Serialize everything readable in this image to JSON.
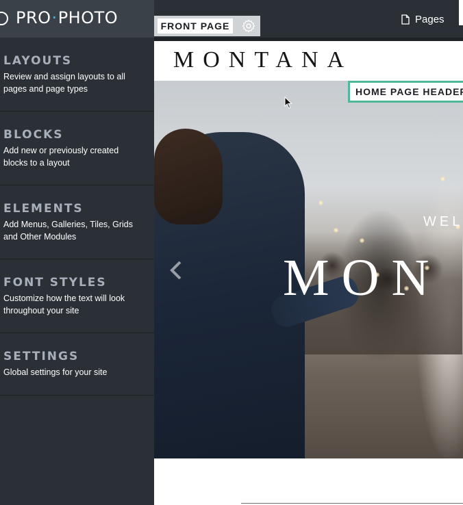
{
  "app": {
    "logo": {
      "left": "PRO",
      "dot": "·",
      "right": "PHOTO"
    }
  },
  "topbar": {
    "pages_label": "Pages"
  },
  "page_tab": {
    "label": "FRONT PAGE"
  },
  "sidebar": {
    "items": [
      {
        "title": "LAYOUTS",
        "description": "Review and assign layouts to all pages and page types"
      },
      {
        "title": "BLOCKS",
        "description": "Add new or previously created blocks to a layout"
      },
      {
        "title": "ELEMENTS",
        "description": "Add Menus, Galleries, Tiles, Grids and Other Modules"
      },
      {
        "title": "FONT STYLES",
        "description": "Customize how the text will look throughout your site"
      },
      {
        "title": "SETTINGS",
        "description": "Global settings for your site"
      }
    ]
  },
  "preview": {
    "site_title": "MONTANA",
    "header_badge": "HOME PAGE HEADER",
    "hero_welcome": "WEL",
    "hero_title": "MON"
  },
  "colors": {
    "accent_badge": "#4fb89a",
    "logo_dot": "#4fb3d9",
    "sidebar_bg": "#2b3036",
    "sidebar_title": "#a7b0ba"
  }
}
